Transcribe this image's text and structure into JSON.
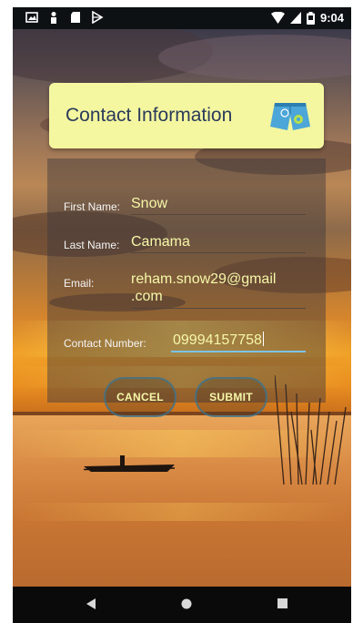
{
  "status_bar": {
    "time": "9:04",
    "left_icons": [
      "gallery-icon",
      "person-icon",
      "sd-card-icon",
      "play-store-icon"
    ],
    "right_icons": [
      "wifi-icon",
      "signal-icon",
      "battery-icon"
    ]
  },
  "header": {
    "title": "Contact Information",
    "icon": "shorts-icon"
  },
  "form": {
    "first_name": {
      "label": "First Name:",
      "value": "Snow"
    },
    "last_name": {
      "label": "Last Name:",
      "value": "Camama"
    },
    "email": {
      "label": "Email:",
      "value_line1": "reham.snow29@gmail",
      "value_line2": ".com"
    },
    "contact_number": {
      "label": "Contact Number:",
      "value": "09994157758"
    }
  },
  "actions": {
    "cancel_label": "CANCEL",
    "submit_label": "SUBMIT"
  },
  "nav_bar": {
    "buttons": [
      "back-icon",
      "home-icon",
      "recents-icon"
    ]
  },
  "colors": {
    "title_card_bg": "#f4f7a0",
    "title_text": "#2b3a5a",
    "value_text": "#f6f7a8",
    "active_underline": "#7cc3e6",
    "button_border": "#3c7896"
  }
}
